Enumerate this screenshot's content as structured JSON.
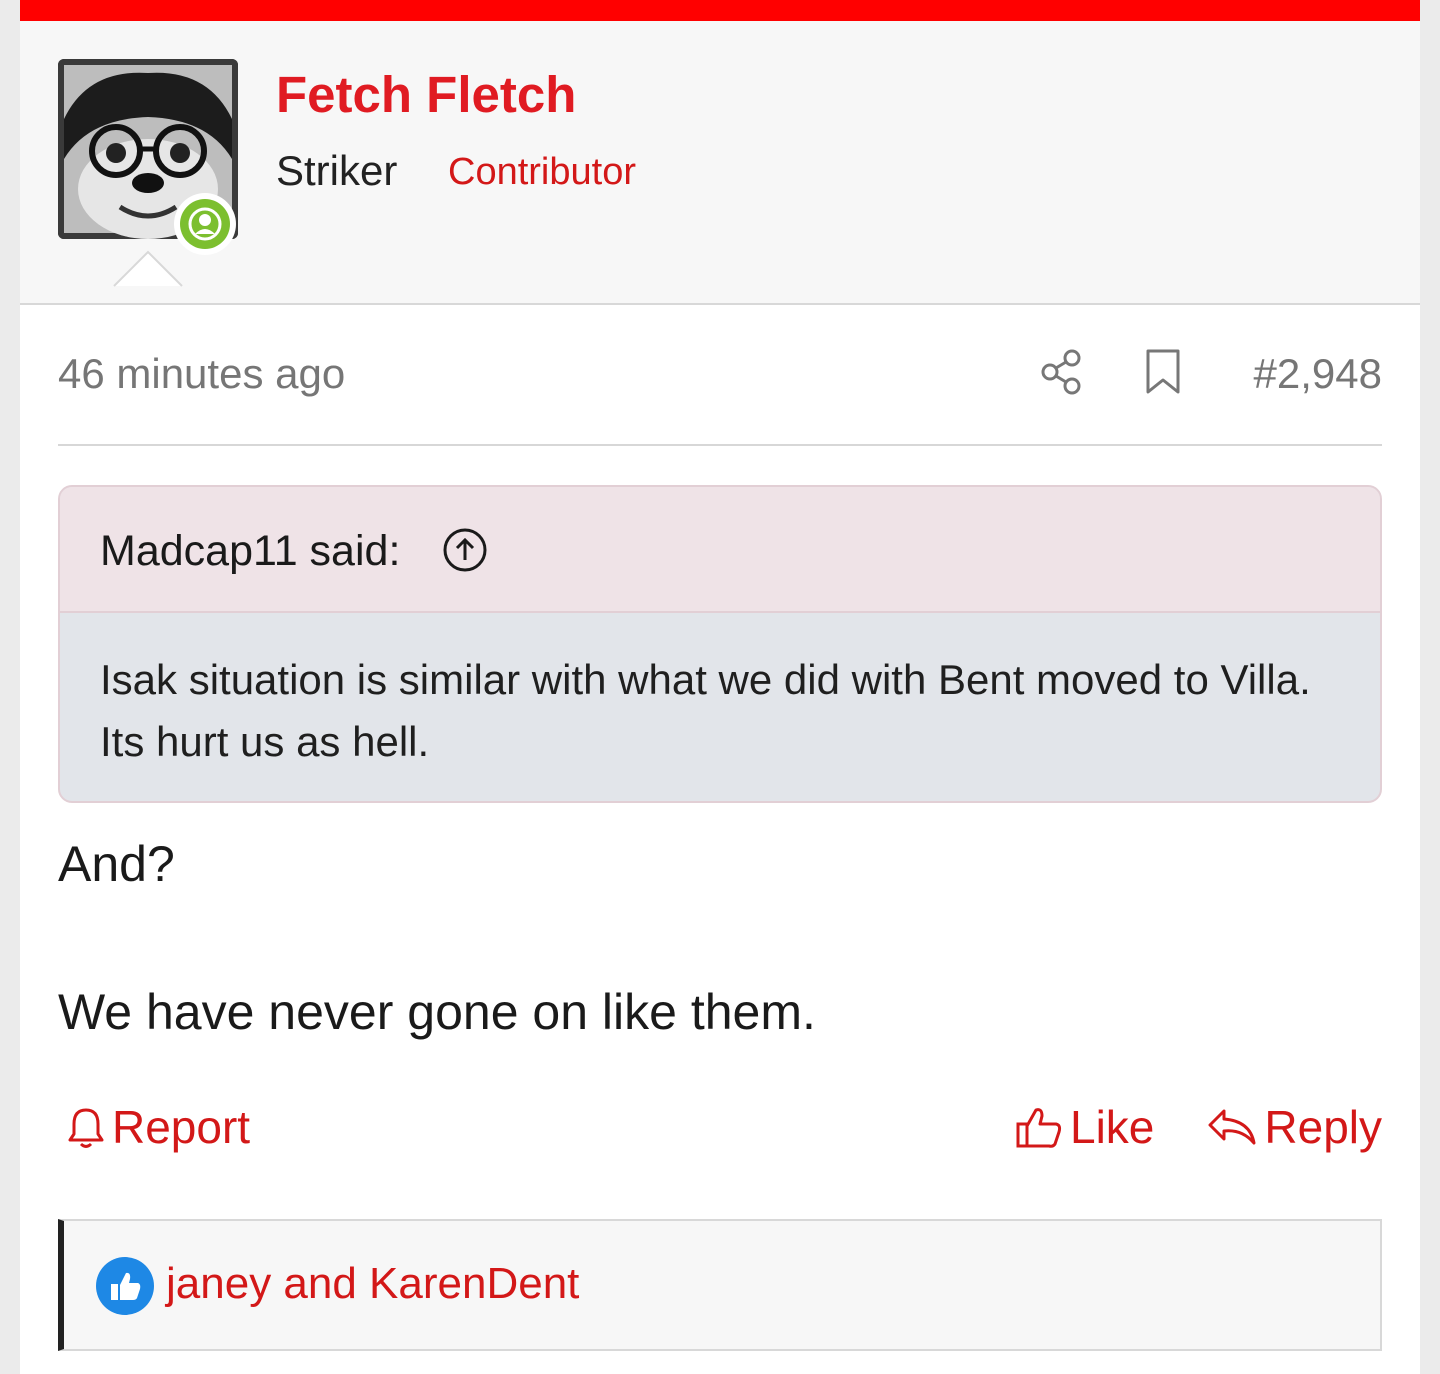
{
  "colors": {
    "brand": "#ff0000",
    "accent": "#d31818",
    "online": "#7cbf2f",
    "like_badge": "#1e88e5"
  },
  "author": {
    "name": "Fetch Fletch",
    "title": "Striker",
    "role": "Contributor",
    "avatar_icon": "avatar",
    "status_icon": "online-user-icon"
  },
  "meta": {
    "timestamp": "46 minutes ago",
    "share_icon": "share-icon",
    "bookmark_icon": "bookmark-icon",
    "post_number": "#2,948"
  },
  "quote": {
    "author": "Madcap11 said:",
    "jump_icon": "arrow-up-circle-icon",
    "text": "Isak situation is similar with what we did with Bent moved to Villa. Its hurt us as hell."
  },
  "message": {
    "paragraphs": [
      "And?",
      "We have never gone on like them."
    ]
  },
  "actions": {
    "report_label": "Report",
    "like_label": "Like",
    "reply_label": "Reply"
  },
  "reactions": {
    "icon": "thumbs-up-icon",
    "text": "janey and KarenDent"
  }
}
